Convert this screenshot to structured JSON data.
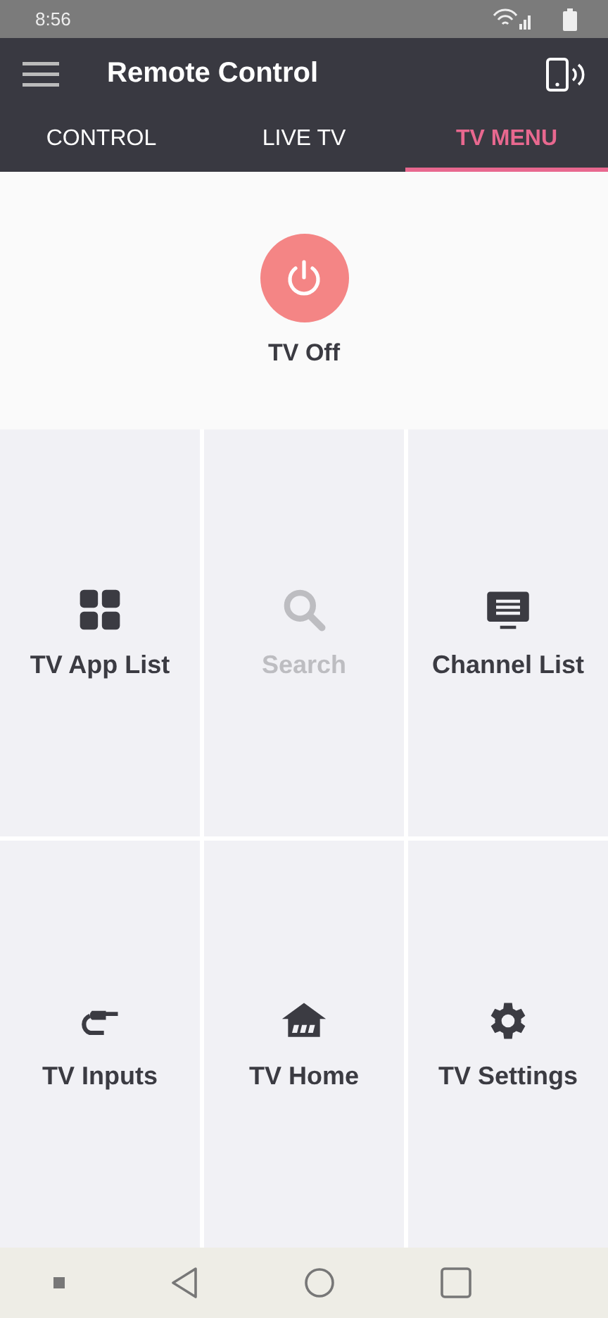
{
  "status_bar": {
    "time": "8:56"
  },
  "app_bar": {
    "title": "Remote Control"
  },
  "tabs": [
    {
      "label": "CONTROL",
      "selected": false
    },
    {
      "label": "LIVE TV",
      "selected": false
    },
    {
      "label": "TV MENU",
      "selected": true
    }
  ],
  "power": {
    "label": "TV Off"
  },
  "tiles": [
    {
      "kind": "apps",
      "label": "TV App List",
      "disabled": false
    },
    {
      "kind": "search",
      "label": "Search",
      "disabled": true
    },
    {
      "kind": "channels",
      "label": "Channel List",
      "disabled": false
    },
    {
      "kind": "inputs",
      "label": "TV Inputs",
      "disabled": false
    },
    {
      "kind": "home",
      "label": "TV Home",
      "disabled": false
    },
    {
      "kind": "settings",
      "label": "TV Settings",
      "disabled": false
    }
  ]
}
